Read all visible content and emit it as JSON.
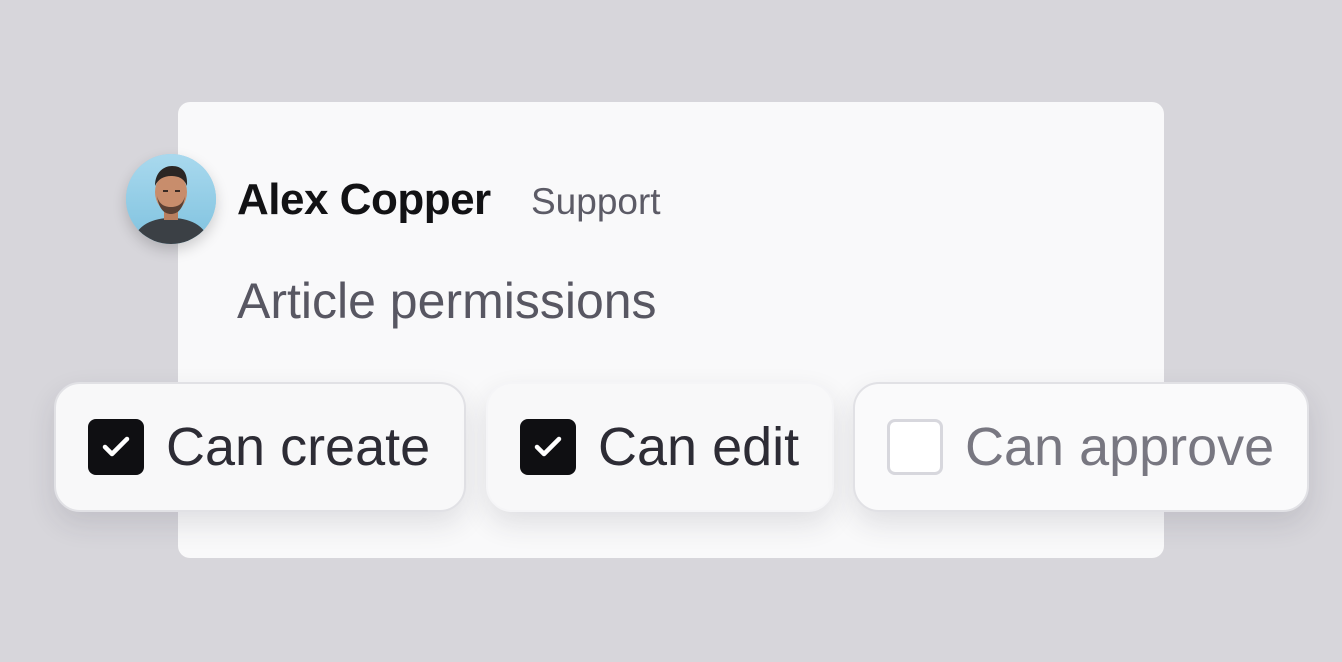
{
  "user": {
    "name": "Alex Copper",
    "role": "Support"
  },
  "section": {
    "title": "Article permissions"
  },
  "permissions": [
    {
      "label": "Can create",
      "checked": true
    },
    {
      "label": "Can edit",
      "checked": true
    },
    {
      "label": "Can approve",
      "checked": false
    }
  ],
  "colors": {
    "background": "#d7d6db",
    "card": "#f9f9fa",
    "checkbox_checked": "#0f0f12"
  },
  "icons": {
    "avatar": "user-avatar-photo",
    "checked": "check-icon"
  }
}
